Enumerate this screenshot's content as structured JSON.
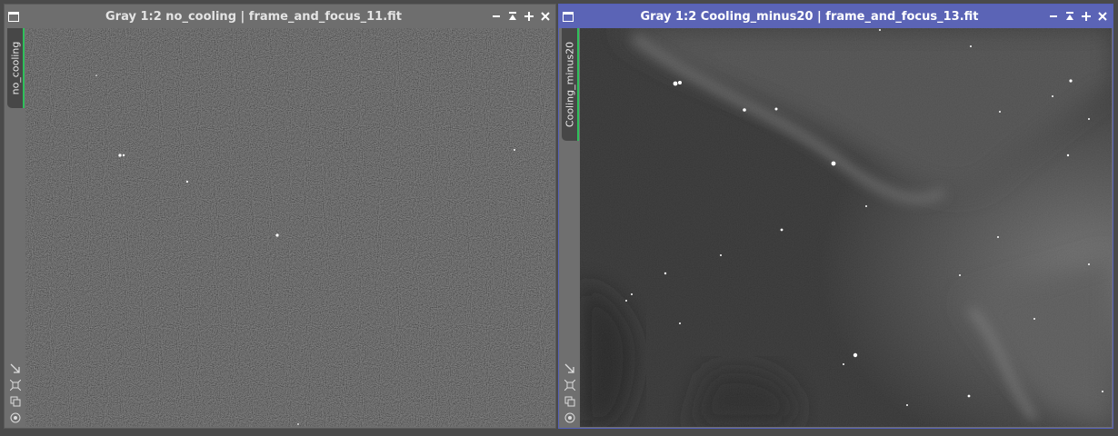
{
  "windows": [
    {
      "title": "Gray 1:2 no_cooling | frame_and_focus_11.fit",
      "tab_label": "no_cooling",
      "active": false
    },
    {
      "title": "Gray 1:2 Cooling_minus20 | frame_and_focus_13.fit",
      "tab_label": "Cooling_minus20",
      "active": true
    }
  ],
  "controls": [
    "minimize-icon",
    "shade-icon",
    "maximize-icon",
    "close-icon"
  ],
  "tools": [
    "auto-stretch-icon",
    "fit-view-icon",
    "clone-icon",
    "identity-icon"
  ],
  "colors": {
    "active_titlebar": "#5b64b6",
    "inactive_titlebar": "#6e6e6e",
    "tab_accent": "#2fbf5a"
  }
}
